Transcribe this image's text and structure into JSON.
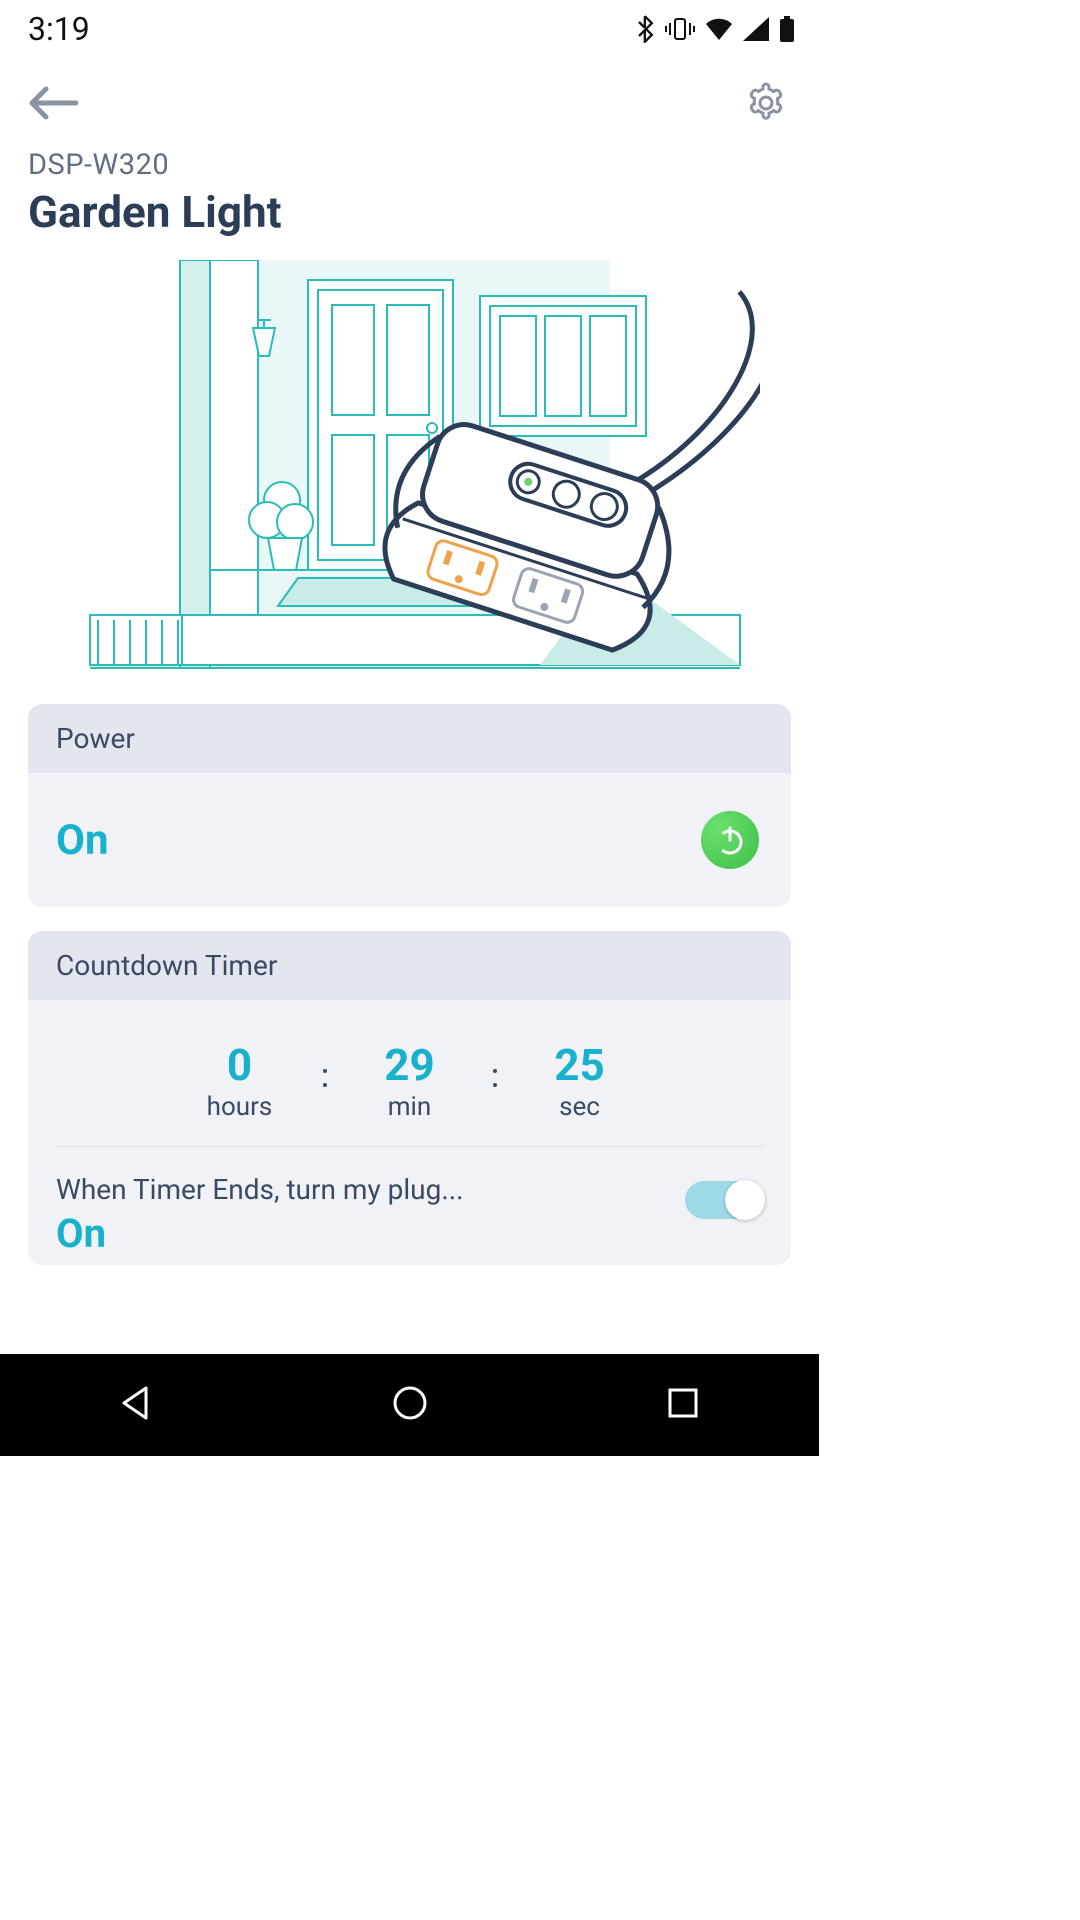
{
  "status": {
    "time": "3:19"
  },
  "header": {
    "model_id": "DSP-W320",
    "device_name": "Garden Light"
  },
  "power_card": {
    "title": "Power",
    "state": "On"
  },
  "countdown_card": {
    "title": "Countdown Timer",
    "hours": "0",
    "min": "29",
    "sec": "25",
    "hours_label": "hours",
    "min_label": "min",
    "sec_label": "sec",
    "action_label": "When Timer Ends, turn my plug...",
    "action_state": "On"
  }
}
